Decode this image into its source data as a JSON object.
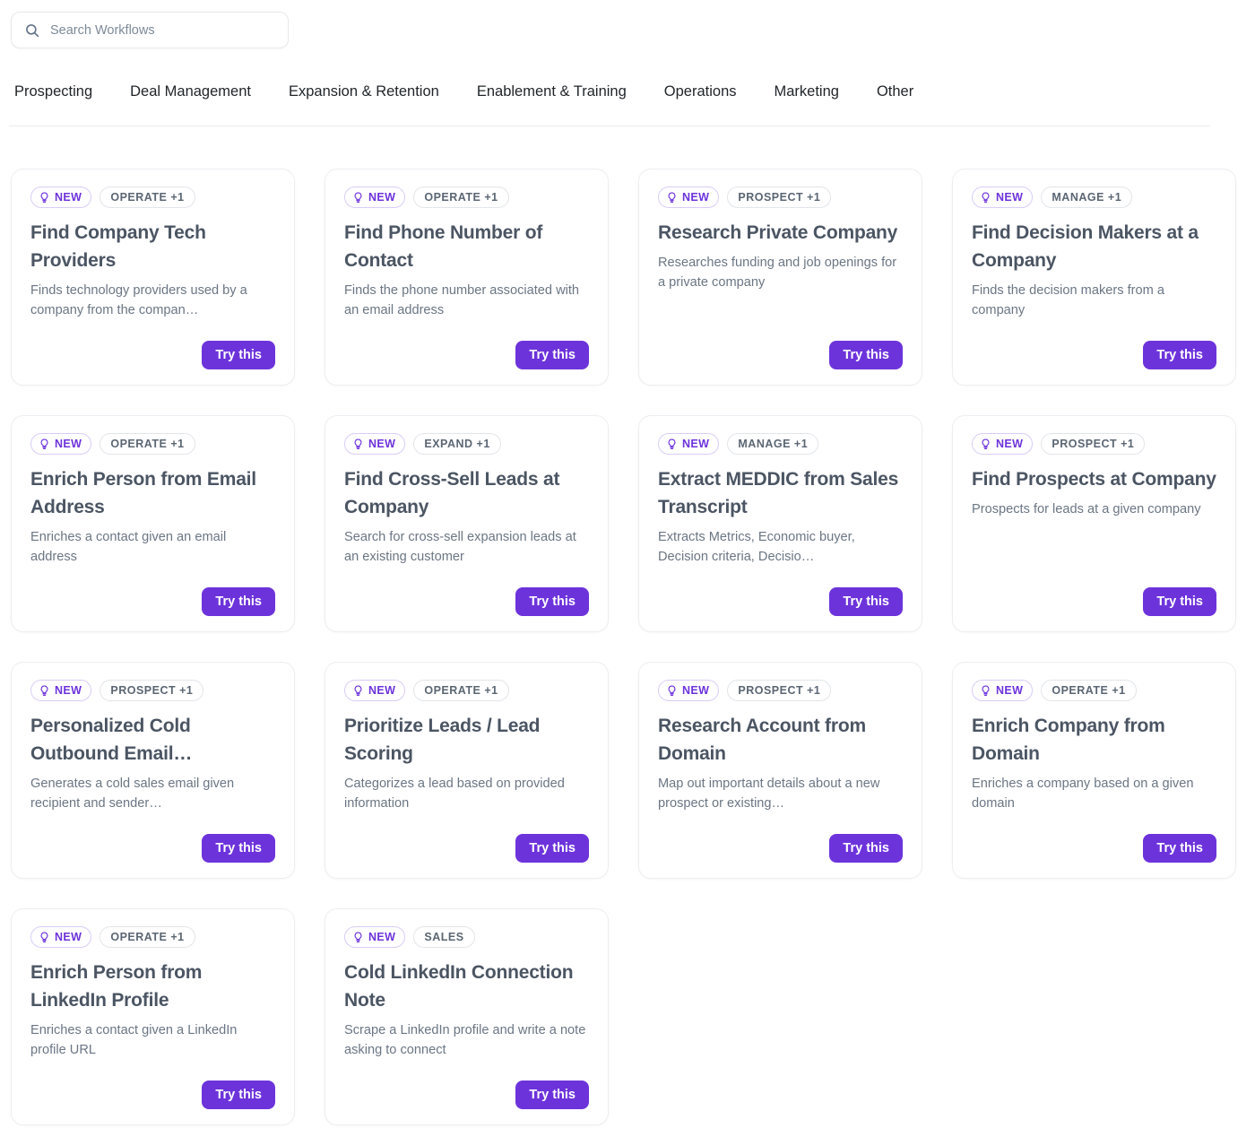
{
  "search": {
    "placeholder": "Search Workflows",
    "value": "",
    "icon": "search-icon"
  },
  "tabs": [
    {
      "label": "Prospecting"
    },
    {
      "label": "Deal Management"
    },
    {
      "label": "Expansion & Retention"
    },
    {
      "label": "Enablement & Training"
    },
    {
      "label": "Operations"
    },
    {
      "label": "Marketing"
    },
    {
      "label": "Other"
    }
  ],
  "colors": {
    "accent": "#6d33db",
    "badge_new_text": "#6d33db",
    "badge_new_border": "#d9cdf5",
    "badge_cat_text": "#5b6673",
    "badge_cat_border": "#e2e5e9",
    "card_border": "#edeef1",
    "title_text": "#4b5563",
    "desc_text": "#6b7684",
    "page_background": "#ffffff"
  },
  "card_defaults": {
    "new_label": "NEW",
    "new_icon": "lightbulb-icon",
    "try_label": "Try this"
  },
  "cards": [
    {
      "new_label": "NEW",
      "category": "OPERATE +1",
      "title": "Find Company Tech Providers",
      "description": "Finds technology providers used by a company from the compan…",
      "try_label": "Try this"
    },
    {
      "new_label": "NEW",
      "category": "OPERATE +1",
      "title": "Find Phone Number of Contact",
      "description": "Finds the phone number associated with an email address",
      "try_label": "Try this"
    },
    {
      "new_label": "NEW",
      "category": "PROSPECT +1",
      "title": "Research Private Company",
      "description": "Researches funding and job openings for a private company",
      "try_label": "Try this"
    },
    {
      "new_label": "NEW",
      "category": "MANAGE +1",
      "title": "Find Decision Makers at a Company",
      "description": "Finds the decision makers from a company",
      "try_label": "Try this"
    },
    {
      "new_label": "NEW",
      "category": "OPERATE +1",
      "title": "Enrich Person from Email Address",
      "description": "Enriches a contact given an email address",
      "try_label": "Try this"
    },
    {
      "new_label": "NEW",
      "category": "EXPAND +1",
      "title": "Find Cross-Sell Leads at Company",
      "description": "Search for cross-sell expansion leads at an existing customer",
      "try_label": "Try this"
    },
    {
      "new_label": "NEW",
      "category": "MANAGE +1",
      "title": "Extract MEDDIC from Sales Transcript",
      "description": "Extracts Metrics, Economic buyer, Decision criteria, Decisio…",
      "try_label": "Try this"
    },
    {
      "new_label": "NEW",
      "category": "PROSPECT +1",
      "title": "Find Prospects at Company",
      "description": "Prospects for leads at a given company",
      "try_label": "Try this"
    },
    {
      "new_label": "NEW",
      "category": "PROSPECT +1",
      "title": "Personalized Cold Outbound Email…",
      "description": "Generates a cold sales email given recipient and sender…",
      "try_label": "Try this"
    },
    {
      "new_label": "NEW",
      "category": "OPERATE +1",
      "title": "Prioritize Leads / Lead Scoring",
      "description": "Categorizes a lead based on provided information",
      "try_label": "Try this"
    },
    {
      "new_label": "NEW",
      "category": "PROSPECT +1",
      "title": "Research Account from Domain",
      "description": "Map out important details about a new prospect or existing…",
      "try_label": "Try this"
    },
    {
      "new_label": "NEW",
      "category": "OPERATE +1",
      "title": "Enrich Company from Domain",
      "description": "Enriches a company based on a given domain",
      "try_label": "Try this"
    },
    {
      "new_label": "NEW",
      "category": "OPERATE +1",
      "title": "Enrich Person from LinkedIn Profile",
      "description": "Enriches a contact given a LinkedIn profile URL",
      "try_label": "Try this"
    },
    {
      "new_label": "NEW",
      "category": "SALES",
      "title": "Cold LinkedIn Connection Note",
      "description": "Scrape a LinkedIn profile and write a note asking to connect",
      "try_label": "Try this"
    }
  ]
}
